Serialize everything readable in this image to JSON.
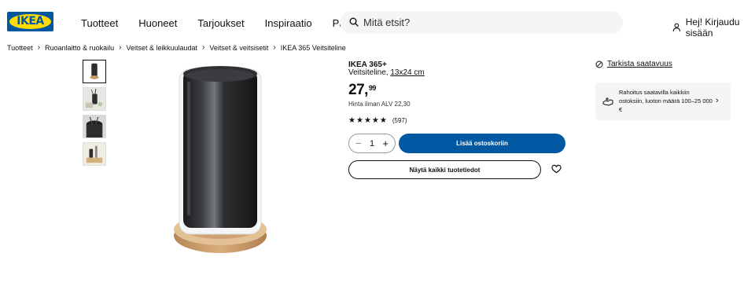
{
  "header": {
    "logo_text": "IKEA",
    "nav": [
      "Tuotteet",
      "Huoneet",
      "Tarjoukset",
      "Inspiraatio",
      "Palvelut"
    ],
    "search_placeholder": "Mitä etsit?",
    "login_label": "Hej! Kirjaudu sisään"
  },
  "breadcrumb": [
    "Tuotteet",
    "Ruoanlaitto & ruokailu",
    "Veitset & leikkuulaudat",
    "Veitset & veitsisetit",
    "IKEA 365 Veitsiteline"
  ],
  "product": {
    "name": "IKEA 365+",
    "type": "Veitsiteline, ",
    "dimensions": "13x24 cm",
    "price_int": "27,",
    "price_dec": "99",
    "vat_text": "Hinta ilman ALV 22,30",
    "rating": 5,
    "review_count": "(597)",
    "quantity": "1",
    "add_to_cart": "Lisää ostoskoriin",
    "show_details": "Näytä kaikki tuotetiedot"
  },
  "availability": {
    "label": "Tarkista saatavuus"
  },
  "financing": {
    "text": "Rahoitus saatavilla kaikkiin ostoksiin, luoton määrä 100–25 000 €"
  },
  "colors": {
    "brand_blue": "#0058a3",
    "brand_yellow": "#ffdb00"
  },
  "icons": [
    "search-icon",
    "user-icon",
    "chevron-right-icon",
    "star-icon",
    "heart-icon",
    "clock-icon",
    "payment-icon",
    "minus-icon",
    "plus-icon"
  ]
}
